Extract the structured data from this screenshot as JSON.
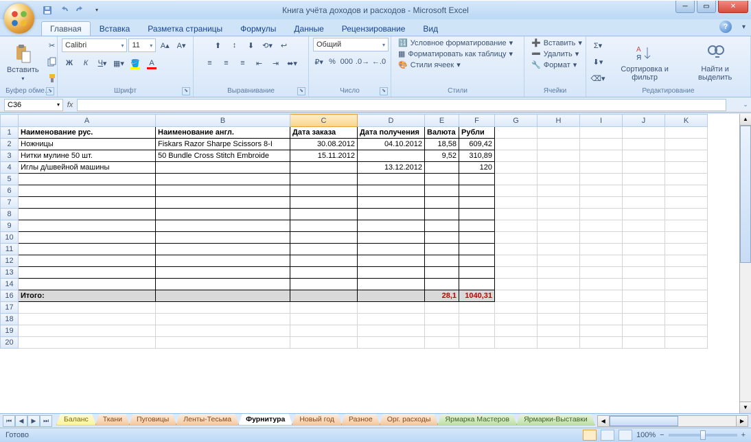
{
  "window": {
    "title": "Книга учёта доходов и расходов - Microsoft Excel"
  },
  "tabs": [
    "Главная",
    "Вставка",
    "Разметка страницы",
    "Формулы",
    "Данные",
    "Рецензирование",
    "Вид"
  ],
  "active_tab": 0,
  "ribbon": {
    "clipboard": {
      "label": "Буфер обме…",
      "paste": "Вставить"
    },
    "font": {
      "label": "Шрифт",
      "name": "Calibri",
      "size": "11"
    },
    "align": {
      "label": "Выравнивание"
    },
    "number": {
      "label": "Число",
      "format": "Общий"
    },
    "styles": {
      "label": "Стили",
      "cond": "Условное форматирование",
      "table": "Форматировать как таблицу",
      "cell": "Стили ячеек"
    },
    "cells": {
      "label": "Ячейки",
      "insert": "Вставить",
      "delete": "Удалить",
      "format": "Формат"
    },
    "editing": {
      "label": "Редактирование",
      "sort": "Сортировка и фильтр",
      "find": "Найти и выделить"
    }
  },
  "namebox": "C36",
  "cols": {
    "A": 200,
    "B": 196,
    "C": 98,
    "D": 98,
    "E": 50,
    "F": 52,
    "G": 62,
    "H": 62,
    "I": 62,
    "J": 62,
    "K": 62
  },
  "headers": {
    "A": "Наименование рус.",
    "B": "Наименование англ.",
    "C": "Дата заказа",
    "D": "Дата получения",
    "E": "Валюта",
    "F": "Рубли"
  },
  "rows": [
    {
      "A": "Ножницы",
      "B": "Fiskars Razor Sharpe Scissors 8-I",
      "C": "30.08.2012",
      "D": "04.10.2012",
      "E": "18,58",
      "F": "609,42"
    },
    {
      "A": "Нитки мулине 50 шт.",
      "B": "50 Bundle Cross Stitch Embroide",
      "C": "15.11.2012",
      "D": "",
      "E": "9,52",
      "F": "310,89"
    },
    {
      "A": "Иглы д/швейной машины",
      "B": "",
      "C": "",
      "D": "13.12.2012",
      "E": "",
      "F": "120"
    }
  ],
  "totals": {
    "label": "Итого:",
    "E": "28,1",
    "F": "1040,31"
  },
  "sheets": [
    {
      "name": "Баланс",
      "cls": "yel"
    },
    {
      "name": "Ткани",
      "cls": ""
    },
    {
      "name": "Пуговицы",
      "cls": ""
    },
    {
      "name": "Ленты-Тесьма",
      "cls": ""
    },
    {
      "name": "Фурнитура",
      "cls": "active"
    },
    {
      "name": "Новый год",
      "cls": ""
    },
    {
      "name": "Разное",
      "cls": ""
    },
    {
      "name": "Орг. расходы",
      "cls": ""
    },
    {
      "name": "Ярмарка Мастеров",
      "cls": "grn"
    },
    {
      "name": "Ярмарки-Выставки",
      "cls": "grn"
    }
  ],
  "status": {
    "ready": "Готово",
    "zoom": "100%"
  }
}
